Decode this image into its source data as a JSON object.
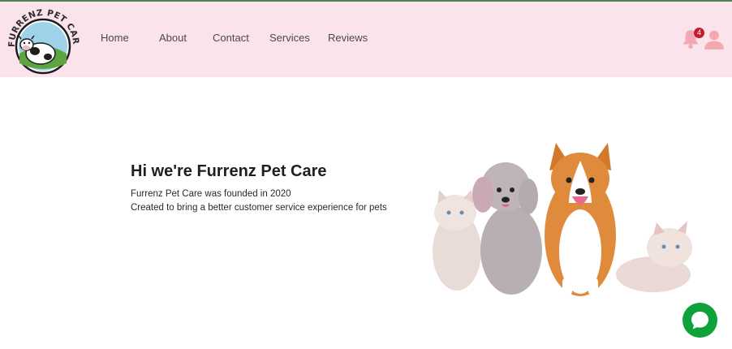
{
  "brand": {
    "logo_text": "FURRENZ PET CARE"
  },
  "nav": {
    "items": [
      {
        "label": "Home"
      },
      {
        "label": "About"
      },
      {
        "label": "Contact"
      },
      {
        "label": "Services"
      },
      {
        "label": "Reviews"
      }
    ]
  },
  "notifications": {
    "count": "4"
  },
  "hero": {
    "title": "Hi we're Furrenz Pet Care",
    "line1": "Furrenz Pet Care was founded in 2020",
    "line2": "Created to bring a better customer service experience for pets"
  },
  "colors": {
    "header_bg": "#fbe3ec",
    "icon_pink": "#f3a9b2",
    "badge_red": "#c21b2b",
    "chat_green": "#10a23a",
    "top_line": "#4f7f52"
  }
}
